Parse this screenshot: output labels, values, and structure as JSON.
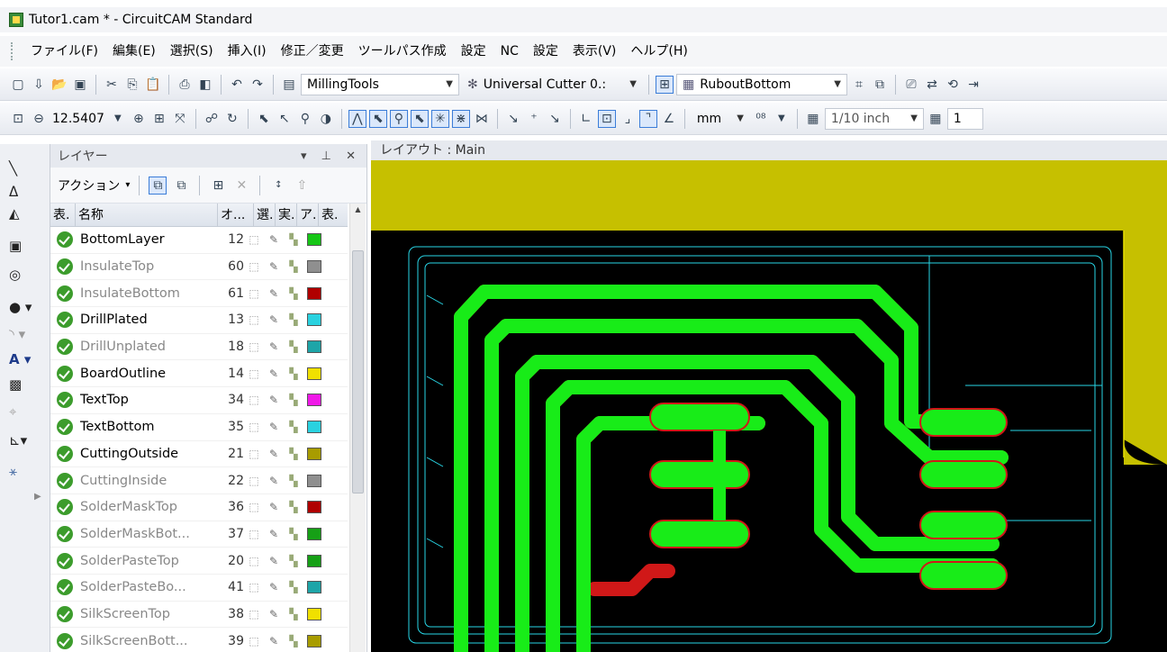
{
  "window": {
    "title": "Tutor1.cam * - CircuitCAM Standard"
  },
  "menu": [
    "ファイル(F)",
    "編集(E)",
    "選択(S)",
    "挿入(I)",
    "修正／変更",
    "ツールパス作成",
    "設定",
    "NC",
    "設定",
    "表示(V)",
    "ヘルプ(H)"
  ],
  "toolbar": {
    "tool_library": "MillingTools",
    "tool": "Universal Cutter 0.:",
    "rubout": "RuboutBottom",
    "zoom": "12.5407",
    "unit": "mm",
    "grid": "1/10 inch",
    "grid2": "1"
  },
  "panel": {
    "title": "レイヤー",
    "action": "アクション",
    "cols": [
      "表.",
      "名称",
      "オ...",
      "選.",
      "実.",
      "ア.",
      "表."
    ]
  },
  "layers": [
    {
      "name": "BottomLayer",
      "num": "12",
      "color": "#16c616",
      "active": true
    },
    {
      "name": "InsulateTop",
      "num": "60",
      "color": "#8f8f8f",
      "active": false
    },
    {
      "name": "InsulateBottom",
      "num": "61",
      "color": "#b00000",
      "active": false
    },
    {
      "name": "DrillPlated",
      "num": "13",
      "color": "#2ad2e0",
      "active": true
    },
    {
      "name": "DrillUnplated",
      "num": "18",
      "color": "#1ea5a8",
      "active": false
    },
    {
      "name": "BoardOutline",
      "num": "14",
      "color": "#f0e000",
      "active": true
    },
    {
      "name": "TextTop",
      "num": "34",
      "color": "#f019e8",
      "active": true
    },
    {
      "name": "TextBottom",
      "num": "35",
      "color": "#2ad2e0",
      "active": true
    },
    {
      "name": "CuttingOutside",
      "num": "21",
      "color": "#a89c00",
      "active": true
    },
    {
      "name": "CuttingInside",
      "num": "22",
      "color": "#8f8f8f",
      "active": false
    },
    {
      "name": "SolderMaskTop",
      "num": "36",
      "color": "#b00000",
      "active": false
    },
    {
      "name": "SolderMaskBot...",
      "num": "37",
      "color": "#16a016",
      "active": false
    },
    {
      "name": "SolderPasteTop",
      "num": "20",
      "color": "#16a016",
      "active": false
    },
    {
      "name": "SolderPasteBo...",
      "num": "41",
      "color": "#1ea5a8",
      "active": false
    },
    {
      "name": "SilkScreenTop",
      "num": "38",
      "color": "#f0e000",
      "active": false
    },
    {
      "name": "SilkScreenBott...",
      "num": "39",
      "color": "#a89c00",
      "active": false
    }
  ],
  "layout": {
    "title": "レイアウト : Main"
  },
  "colors": {
    "board": "#c6c000",
    "trace": "#18ec18",
    "isolation": "#d01818",
    "contour": "#28d6e6"
  }
}
